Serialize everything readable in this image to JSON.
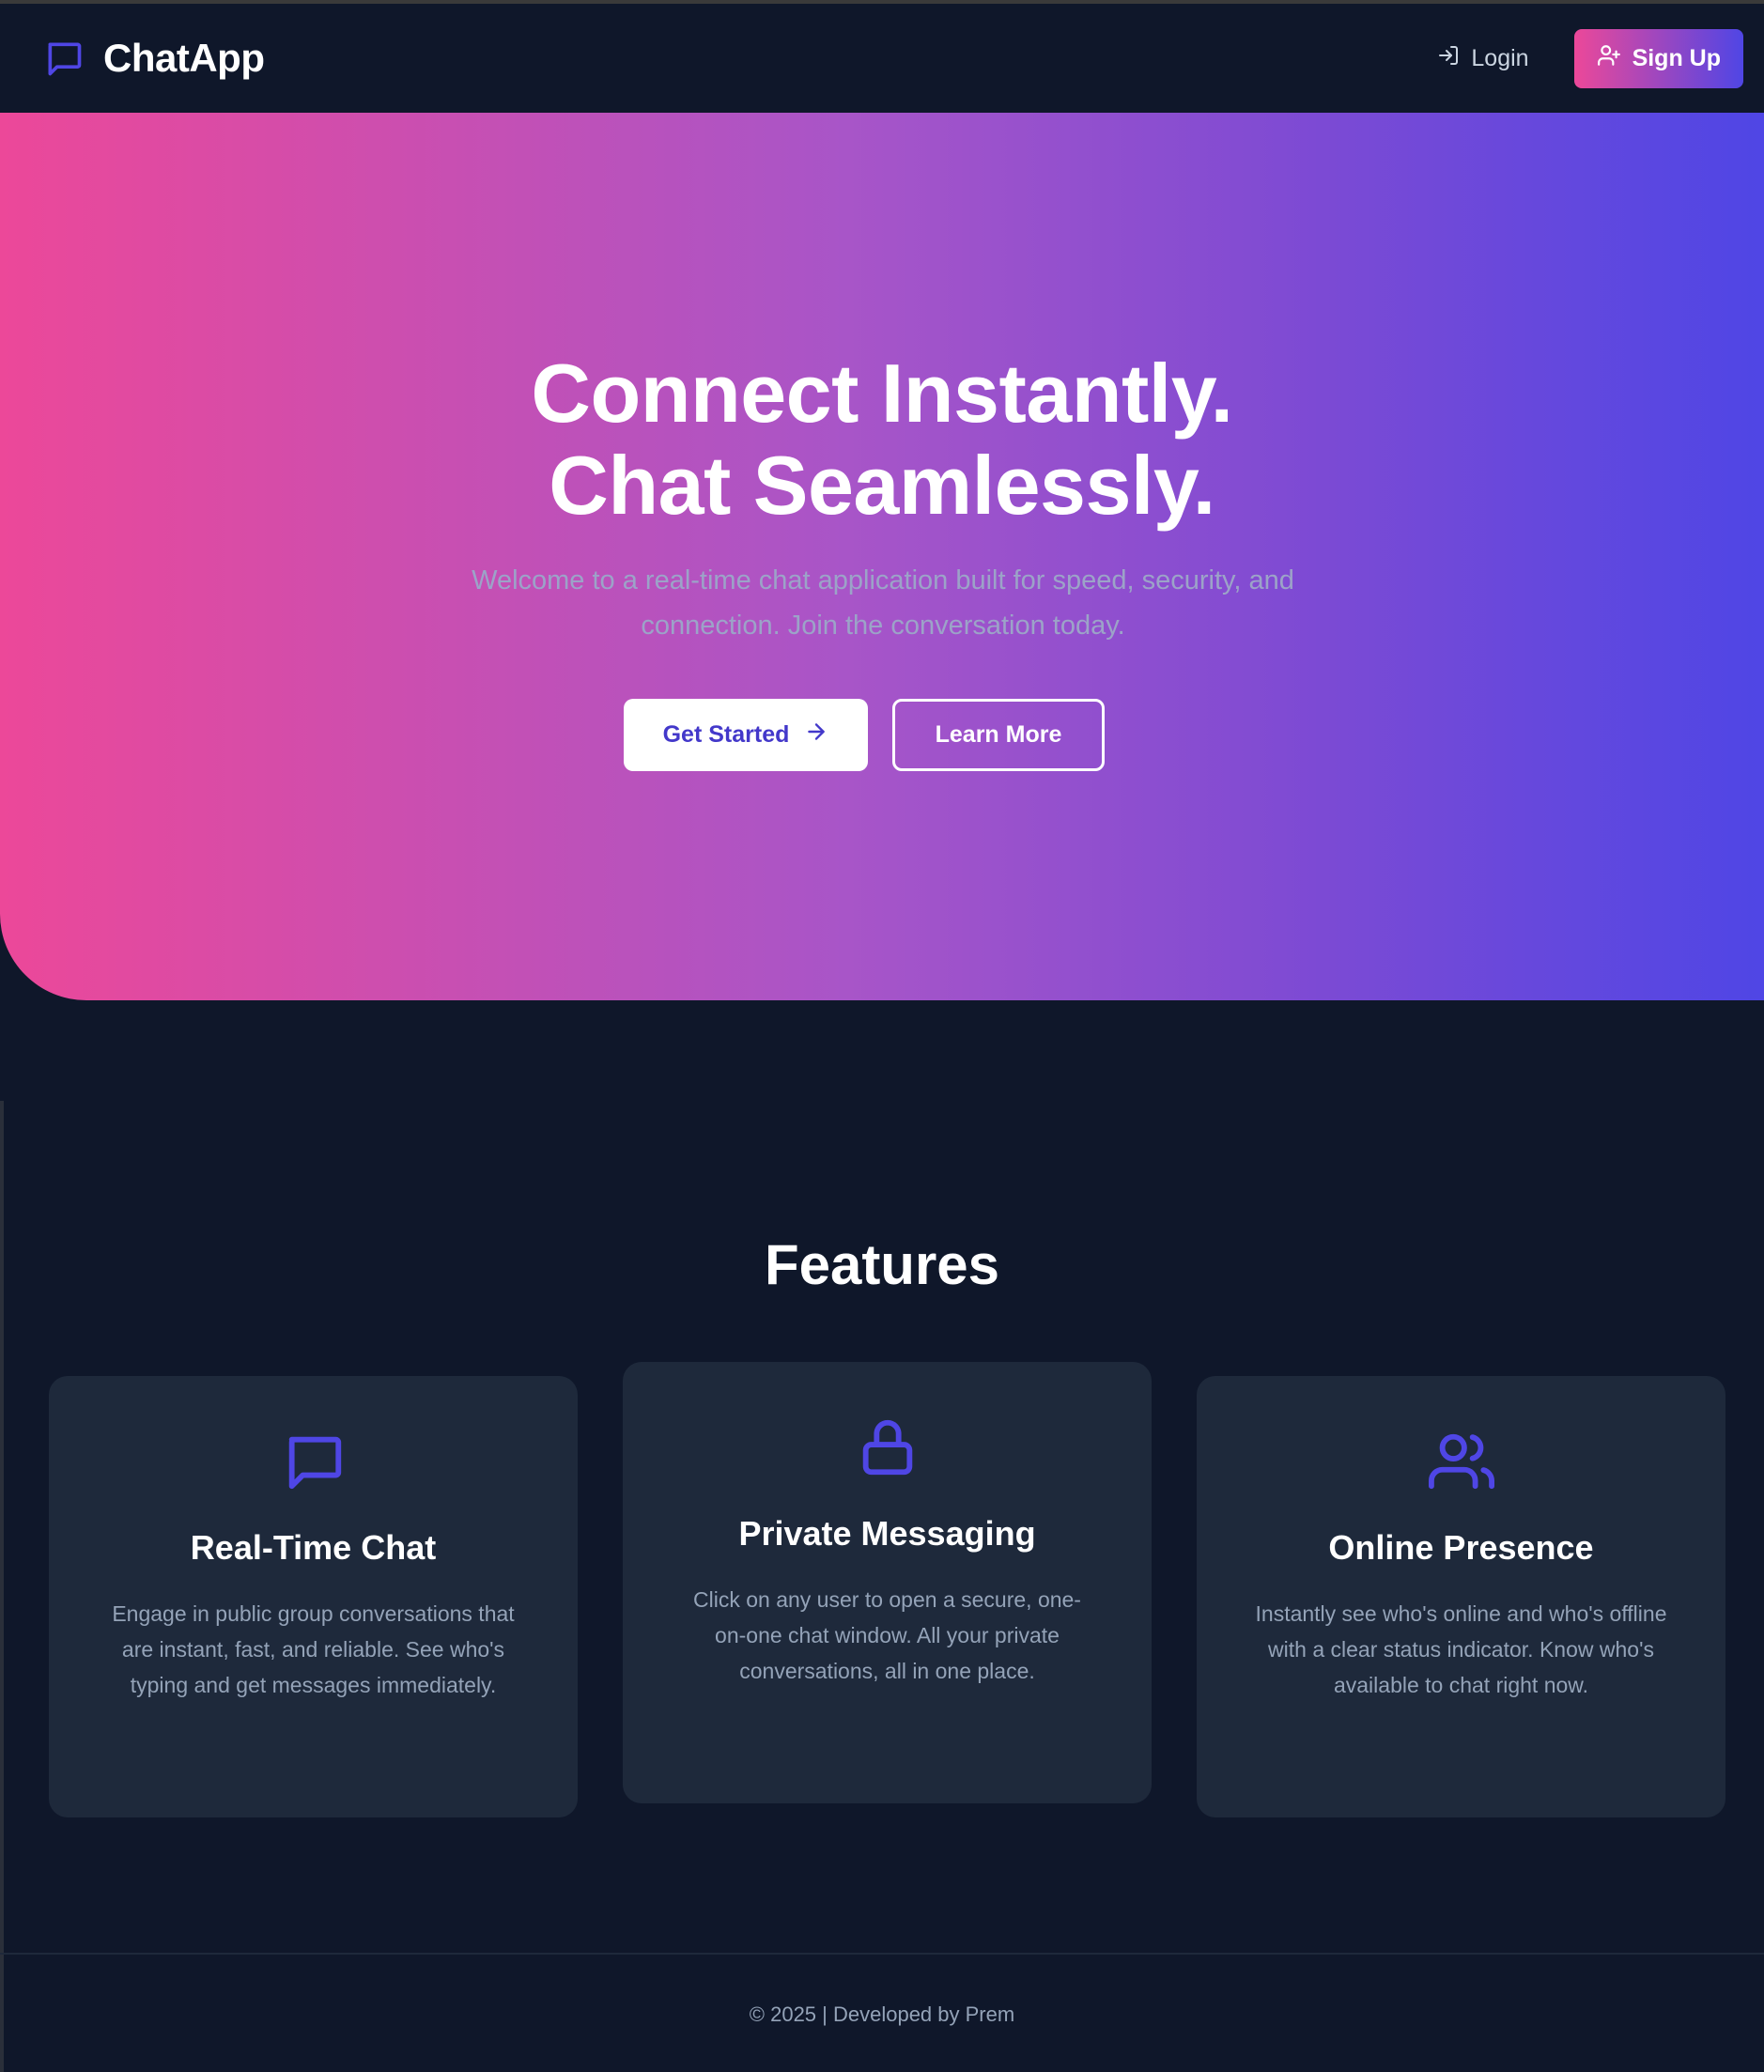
{
  "navbar": {
    "brand_name": "ChatApp",
    "brand_icon": "chat-bubble-icon",
    "login_label": "Login",
    "signup_label": "Sign Up"
  },
  "hero": {
    "title_line1": "Connect Instantly.",
    "title_line2": "Chat Seamlessly.",
    "subtitle": "Welcome to a real-time chat application built for speed, security, and connection. Join the conversation today.",
    "primary_button": "Get Started",
    "secondary_button": "Learn More",
    "gradient_start": "#ec4899",
    "gradient_end": "#4f46e5"
  },
  "features": {
    "title": "Features",
    "items": [
      {
        "icon": "chat-bubble-icon",
        "title": "Real-Time Chat",
        "description": "Engage in public group conversations that are instant, fast, and reliable. See who's typing and get messages immediately."
      },
      {
        "icon": "lock-icon",
        "title": "Private Messaging",
        "description": "Click on any user to open a secure, one-on-one chat window. All your private conversations, all in one place."
      },
      {
        "icon": "users-icon",
        "title": "Online Presence",
        "description": "Instantly see who's online and who's offline with a clear status indicator. Know who's available to chat right now."
      }
    ]
  },
  "footer": {
    "text": "© 2025 | Developed by Prem"
  },
  "colors": {
    "background": "#0f172a",
    "card": "#1e293b",
    "accent": "#4f46e5"
  }
}
